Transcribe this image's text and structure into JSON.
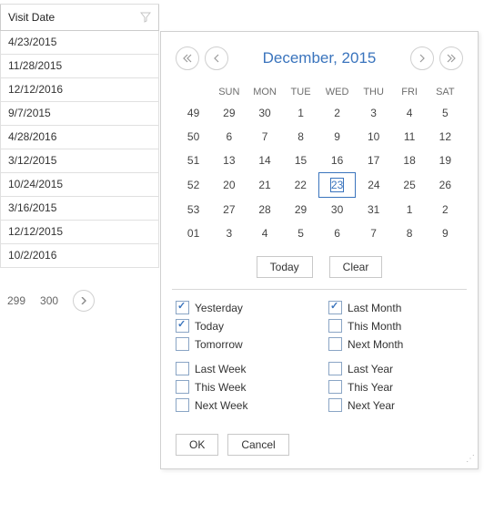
{
  "grid": {
    "header": "Visit Date",
    "rows": [
      "4/23/2015",
      "11/28/2015",
      "12/12/2016",
      "9/7/2015",
      "4/28/2016",
      "3/12/2015",
      "10/24/2015",
      "3/16/2015",
      "12/12/2015",
      "10/2/2016"
    ]
  },
  "pager": {
    "pages": [
      "299",
      "300"
    ]
  },
  "calendar": {
    "title": "December, 2015",
    "dow": [
      "SUN",
      "MON",
      "TUE",
      "WED",
      "THU",
      "FRI",
      "SAT"
    ],
    "weeks": [
      {
        "wk": "49",
        "days": [
          {
            "n": "29",
            "c": "out"
          },
          {
            "n": "30",
            "c": "out"
          },
          {
            "n": "1"
          },
          {
            "n": "2"
          },
          {
            "n": "3"
          },
          {
            "n": "4"
          },
          {
            "n": "5",
            "c": "red"
          }
        ]
      },
      {
        "wk": "50",
        "days": [
          {
            "n": "6",
            "c": "red"
          },
          {
            "n": "7"
          },
          {
            "n": "8"
          },
          {
            "n": "9"
          },
          {
            "n": "10"
          },
          {
            "n": "11"
          },
          {
            "n": "12",
            "c": "red"
          }
        ]
      },
      {
        "wk": "51",
        "days": [
          {
            "n": "13",
            "c": "red"
          },
          {
            "n": "14"
          },
          {
            "n": "15"
          },
          {
            "n": "16"
          },
          {
            "n": "17"
          },
          {
            "n": "18"
          },
          {
            "n": "19",
            "c": "red"
          }
        ]
      },
      {
        "wk": "52",
        "days": [
          {
            "n": "20",
            "c": "red"
          },
          {
            "n": "21"
          },
          {
            "n": "22"
          },
          {
            "n": "23",
            "c": "today"
          },
          {
            "n": "24"
          },
          {
            "n": "25"
          },
          {
            "n": "26",
            "c": "red"
          }
        ]
      },
      {
        "wk": "53",
        "days": [
          {
            "n": "27",
            "c": "red"
          },
          {
            "n": "28"
          },
          {
            "n": "29"
          },
          {
            "n": "30"
          },
          {
            "n": "31"
          },
          {
            "n": "1",
            "c": "out"
          },
          {
            "n": "2",
            "c": "out"
          }
        ]
      },
      {
        "wk": "01",
        "days": [
          {
            "n": "3",
            "c": "out"
          },
          {
            "n": "4",
            "c": "out"
          },
          {
            "n": "5",
            "c": "out"
          },
          {
            "n": "6",
            "c": "out"
          },
          {
            "n": "7",
            "c": "out"
          },
          {
            "n": "8",
            "c": "out"
          },
          {
            "n": "9",
            "c": "out"
          }
        ]
      }
    ],
    "today": "Today",
    "clear": "Clear"
  },
  "filters": {
    "col1": [
      [
        {
          "label": "Yesterday",
          "checked": true
        },
        {
          "label": "Today",
          "checked": true
        },
        {
          "label": "Tomorrow",
          "checked": false
        }
      ],
      [
        {
          "label": "Last Week",
          "checked": false
        },
        {
          "label": "This Week",
          "checked": false
        },
        {
          "label": "Next Week",
          "checked": false
        }
      ]
    ],
    "col2": [
      [
        {
          "label": "Last Month",
          "checked": true
        },
        {
          "label": "This Month",
          "checked": false
        },
        {
          "label": "Next Month",
          "checked": false
        }
      ],
      [
        {
          "label": "Last Year",
          "checked": false
        },
        {
          "label": "This Year",
          "checked": false
        },
        {
          "label": "Next Year",
          "checked": false
        }
      ]
    ]
  },
  "actions": {
    "ok": "OK",
    "cancel": "Cancel"
  }
}
